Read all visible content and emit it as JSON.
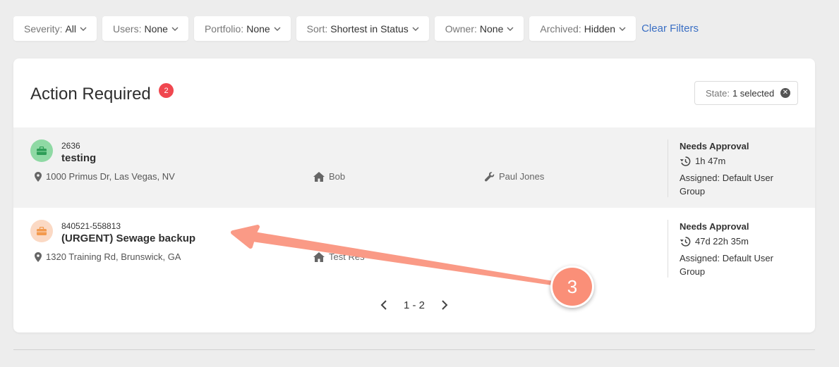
{
  "filters": [
    {
      "key": "Severity:",
      "value": "All"
    },
    {
      "key": "Users:",
      "value": "None"
    },
    {
      "key": "Portfolio:",
      "value": "None"
    },
    {
      "key": "Sort:",
      "value": "Shortest in Status"
    },
    {
      "key": "Owner:",
      "value": "None"
    },
    {
      "key": "Archived:",
      "value": "Hidden"
    }
  ],
  "clear_filters": "Clear Filters",
  "card": {
    "title": "Action Required",
    "count": "2",
    "state_filter": {
      "key": "State:",
      "value": "1 selected"
    }
  },
  "rows": [
    {
      "number": "2636",
      "title": "testing",
      "address": "1000 Primus Dr, Las Vegas, NV",
      "resident": "Bob",
      "technician": "Paul Jones",
      "status": "Needs Approval",
      "elapsed": "1h 47m",
      "assigned": "Assigned: Default User Group",
      "icon_color": "#8fd9a4"
    },
    {
      "number": "840521-558813",
      "title": "(URGENT) Sewage backup",
      "address": "1320 Training Rd, Brunswick, GA",
      "resident": "Test Res",
      "status": "Needs Approval",
      "elapsed": "47d 22h 35m",
      "assigned": "Assigned: Default User Group",
      "icon_color": "#fbd9c4"
    }
  ],
  "pagination": {
    "range": "1 - 2"
  },
  "annotation": {
    "step": "3",
    "color": "#fa8f78"
  }
}
